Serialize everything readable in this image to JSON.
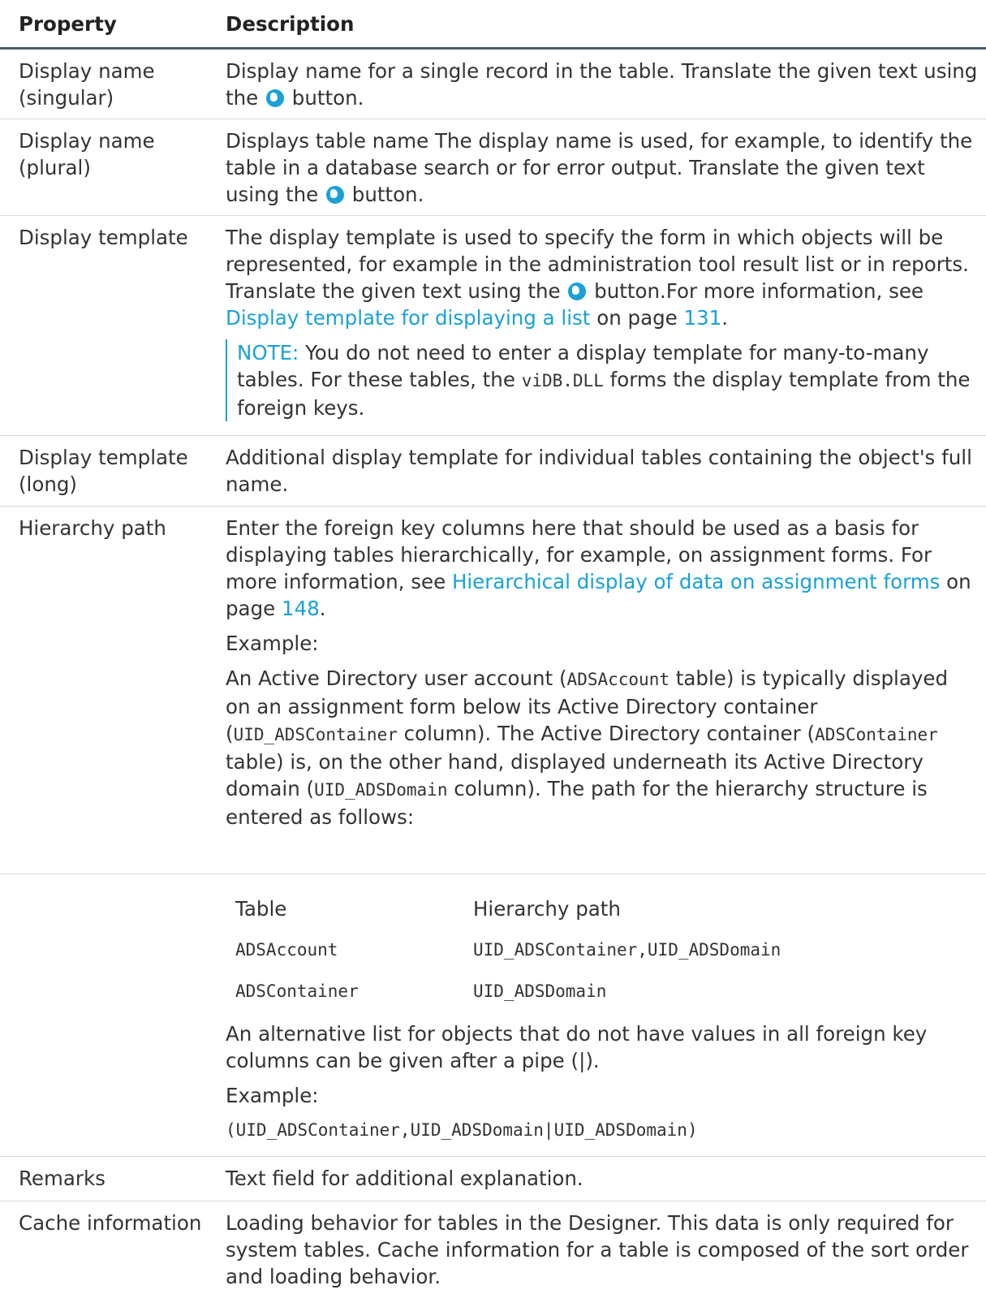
{
  "header": {
    "property": "Property",
    "description": "Description"
  },
  "rows": {
    "display_name_singular": {
      "property": "Display name (singular)",
      "desc_before": "Display name for a single record in the table. Translate the given text using the",
      "desc_after": " button."
    },
    "display_name_plural": {
      "property": "Display name (plural)",
      "desc_before": "Displays table name The display name is used, for example, to identify the table in a database search or for error output. Translate the given text using the",
      "desc_after": " button."
    },
    "display_template": {
      "property": "Display template",
      "desc_before": "The display template is used to specify the form in which objects will be represented, for example in the administration tool result list or in reports. Translate the given text using the",
      "desc_after": " button.For more information, see ",
      "link_text": "Display template for displaying a list",
      "on_page": " on page ",
      "page": "131",
      "period": ".",
      "note_label": "NOTE:",
      "note_before": " You do not need to enter a display template for many-to-many tables. For these tables, the ",
      "note_code": "viDB.DLL",
      "note_after": " forms the display template from the foreign keys."
    },
    "display_template_long": {
      "property": "Display template (long)",
      "desc": "Additional display template for individual tables containing the object's full name."
    },
    "hierarchy_path": {
      "property": "Hierarchy path",
      "desc_intro": "Enter the foreign key columns here that should be used as a basis for displaying tables hierarchically, for example, on assignment forms. For more information, see ",
      "link_text": "Hierarchical display of data on assignment forms",
      "on_page": " on page ",
      "page": "148",
      "period": ".",
      "example_label": "Example:",
      "ex_p1": "An Active Directory user account (",
      "ex_c1": "ADSAccount",
      "ex_p2": " table) is typically displayed on an assignment form below its Active Directory container (",
      "ex_c2": "UID_ADSContainer",
      "ex_p3": " column). The Active Directory container (",
      "ex_c3": "ADSContainer",
      "ex_p4": " table) is, on the other hand, displayed underneath its Active Directory domain (",
      "ex_c4": "UID_ADSDomain",
      "ex_p5": " column). The path for the hierarchy structure is entered as follows:",
      "inner_table": {
        "head": [
          "Table",
          "Hierarchy path"
        ],
        "rows": [
          [
            "ADSAccount",
            "UID_ADSContainer,UID_ADSDomain"
          ],
          [
            "ADSContainer",
            "UID_ADSDomain"
          ]
        ]
      },
      "alt_text": "An alternative list for objects that do not have values in all foreign key columns can be given after a pipe (|).",
      "example_label_2": "Example:",
      "example_code": "(UID_ADSContainer,UID_ADSDomain|UID_ADSDomain)"
    },
    "remarks": {
      "property": "Remarks",
      "desc": "Text field for additional explanation."
    },
    "cache_information": {
      "property": "Cache information",
      "desc": "Loading behavior for tables in the Designer. This data is only required for system tables. Cache information for a table is composed of the sort order and loading behavior."
    }
  },
  "icons": {
    "translate_button": "globe-icon"
  },
  "colors": {
    "link": "#1aa1d6",
    "text": "#333333",
    "header_rule": "#4a5a66"
  }
}
